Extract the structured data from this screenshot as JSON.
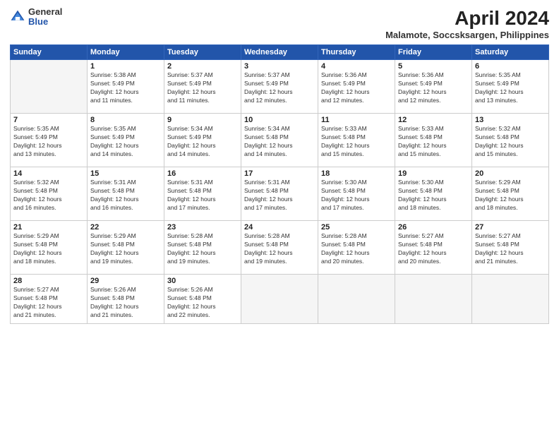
{
  "header": {
    "logo_general": "General",
    "logo_blue": "Blue",
    "title": "April 2024",
    "subtitle": "Malamote, Soccsksargen, Philippines"
  },
  "weekdays": [
    "Sunday",
    "Monday",
    "Tuesday",
    "Wednesday",
    "Thursday",
    "Friday",
    "Saturday"
  ],
  "weeks": [
    [
      {
        "day": "",
        "info": ""
      },
      {
        "day": "1",
        "info": "Sunrise: 5:38 AM\nSunset: 5:49 PM\nDaylight: 12 hours\nand 11 minutes."
      },
      {
        "day": "2",
        "info": "Sunrise: 5:37 AM\nSunset: 5:49 PM\nDaylight: 12 hours\nand 11 minutes."
      },
      {
        "day": "3",
        "info": "Sunrise: 5:37 AM\nSunset: 5:49 PM\nDaylight: 12 hours\nand 12 minutes."
      },
      {
        "day": "4",
        "info": "Sunrise: 5:36 AM\nSunset: 5:49 PM\nDaylight: 12 hours\nand 12 minutes."
      },
      {
        "day": "5",
        "info": "Sunrise: 5:36 AM\nSunset: 5:49 PM\nDaylight: 12 hours\nand 12 minutes."
      },
      {
        "day": "6",
        "info": "Sunrise: 5:35 AM\nSunset: 5:49 PM\nDaylight: 12 hours\nand 13 minutes."
      }
    ],
    [
      {
        "day": "7",
        "info": "Sunrise: 5:35 AM\nSunset: 5:49 PM\nDaylight: 12 hours\nand 13 minutes."
      },
      {
        "day": "8",
        "info": "Sunrise: 5:35 AM\nSunset: 5:49 PM\nDaylight: 12 hours\nand 14 minutes."
      },
      {
        "day": "9",
        "info": "Sunrise: 5:34 AM\nSunset: 5:49 PM\nDaylight: 12 hours\nand 14 minutes."
      },
      {
        "day": "10",
        "info": "Sunrise: 5:34 AM\nSunset: 5:48 PM\nDaylight: 12 hours\nand 14 minutes."
      },
      {
        "day": "11",
        "info": "Sunrise: 5:33 AM\nSunset: 5:48 PM\nDaylight: 12 hours\nand 15 minutes."
      },
      {
        "day": "12",
        "info": "Sunrise: 5:33 AM\nSunset: 5:48 PM\nDaylight: 12 hours\nand 15 minutes."
      },
      {
        "day": "13",
        "info": "Sunrise: 5:32 AM\nSunset: 5:48 PM\nDaylight: 12 hours\nand 15 minutes."
      }
    ],
    [
      {
        "day": "14",
        "info": "Sunrise: 5:32 AM\nSunset: 5:48 PM\nDaylight: 12 hours\nand 16 minutes."
      },
      {
        "day": "15",
        "info": "Sunrise: 5:31 AM\nSunset: 5:48 PM\nDaylight: 12 hours\nand 16 minutes."
      },
      {
        "day": "16",
        "info": "Sunrise: 5:31 AM\nSunset: 5:48 PM\nDaylight: 12 hours\nand 17 minutes."
      },
      {
        "day": "17",
        "info": "Sunrise: 5:31 AM\nSunset: 5:48 PM\nDaylight: 12 hours\nand 17 minutes."
      },
      {
        "day": "18",
        "info": "Sunrise: 5:30 AM\nSunset: 5:48 PM\nDaylight: 12 hours\nand 17 minutes."
      },
      {
        "day": "19",
        "info": "Sunrise: 5:30 AM\nSunset: 5:48 PM\nDaylight: 12 hours\nand 18 minutes."
      },
      {
        "day": "20",
        "info": "Sunrise: 5:29 AM\nSunset: 5:48 PM\nDaylight: 12 hours\nand 18 minutes."
      }
    ],
    [
      {
        "day": "21",
        "info": "Sunrise: 5:29 AM\nSunset: 5:48 PM\nDaylight: 12 hours\nand 18 minutes."
      },
      {
        "day": "22",
        "info": "Sunrise: 5:29 AM\nSunset: 5:48 PM\nDaylight: 12 hours\nand 19 minutes."
      },
      {
        "day": "23",
        "info": "Sunrise: 5:28 AM\nSunset: 5:48 PM\nDaylight: 12 hours\nand 19 minutes."
      },
      {
        "day": "24",
        "info": "Sunrise: 5:28 AM\nSunset: 5:48 PM\nDaylight: 12 hours\nand 19 minutes."
      },
      {
        "day": "25",
        "info": "Sunrise: 5:28 AM\nSunset: 5:48 PM\nDaylight: 12 hours\nand 20 minutes."
      },
      {
        "day": "26",
        "info": "Sunrise: 5:27 AM\nSunset: 5:48 PM\nDaylight: 12 hours\nand 20 minutes."
      },
      {
        "day": "27",
        "info": "Sunrise: 5:27 AM\nSunset: 5:48 PM\nDaylight: 12 hours\nand 21 minutes."
      }
    ],
    [
      {
        "day": "28",
        "info": "Sunrise: 5:27 AM\nSunset: 5:48 PM\nDaylight: 12 hours\nand 21 minutes."
      },
      {
        "day": "29",
        "info": "Sunrise: 5:26 AM\nSunset: 5:48 PM\nDaylight: 12 hours\nand 21 minutes."
      },
      {
        "day": "30",
        "info": "Sunrise: 5:26 AM\nSunset: 5:48 PM\nDaylight: 12 hours\nand 22 minutes."
      },
      {
        "day": "",
        "info": ""
      },
      {
        "day": "",
        "info": ""
      },
      {
        "day": "",
        "info": ""
      },
      {
        "day": "",
        "info": ""
      }
    ]
  ]
}
